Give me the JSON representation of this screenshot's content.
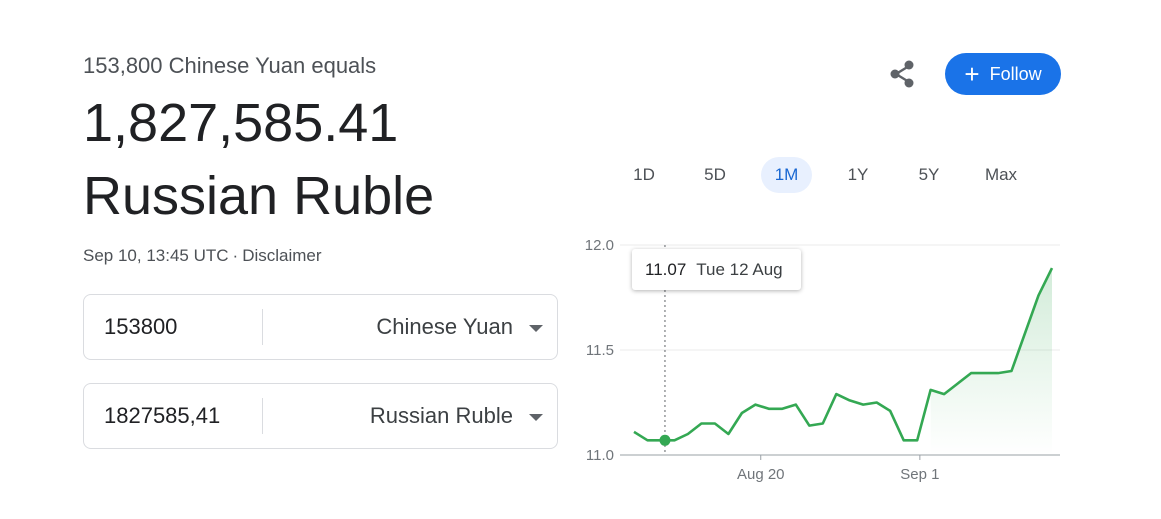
{
  "header": {
    "equals_text": "153,800 Chinese Yuan equals",
    "amount": "1,827,585.41",
    "currency_name": "Russian Ruble",
    "timestamp": "Sep 10, 13:45 UTC",
    "separator": "·",
    "disclaimer": "Disclaimer"
  },
  "converter": {
    "from": {
      "value": "153800",
      "currency": "Chinese Yuan"
    },
    "to": {
      "value": "1827585,41",
      "currency": "Russian Ruble"
    }
  },
  "actions": {
    "share_icon": "share-icon",
    "follow_label": "Follow",
    "follow_plus": "+",
    "follow_color": "#1a73e8"
  },
  "tabs": [
    {
      "label": "1D",
      "active": false
    },
    {
      "label": "5D",
      "active": false
    },
    {
      "label": "1M",
      "active": true
    },
    {
      "label": "1Y",
      "active": false
    },
    {
      "label": "5Y",
      "active": false
    },
    {
      "label": "Max",
      "active": false
    }
  ],
  "tooltip": {
    "value": "11.07",
    "date": "Tue 12 Aug"
  },
  "chart_data": {
    "type": "line",
    "ylim": [
      11.0,
      12.0
    ],
    "yticks": [
      "12.0",
      "11.5",
      "11.0"
    ],
    "xticks": [
      "Aug 20",
      "Sep 1"
    ],
    "line_color": "#34a853",
    "grid": true,
    "series": [
      {
        "values": [
          11.11,
          11.07,
          11.07,
          11.07,
          11.1,
          11.15,
          11.15,
          11.1,
          11.2,
          11.24,
          11.22,
          11.22,
          11.24,
          11.14,
          11.15,
          11.29,
          11.26,
          11.24,
          11.25,
          11.21,
          11.07,
          11.07,
          11.31,
          11.29,
          11.34,
          11.39,
          11.39,
          11.39,
          11.4,
          11.58,
          11.76,
          11.89
        ]
      }
    ],
    "highlight": {
      "value": 11.07,
      "label": "Tue 12 Aug"
    }
  }
}
